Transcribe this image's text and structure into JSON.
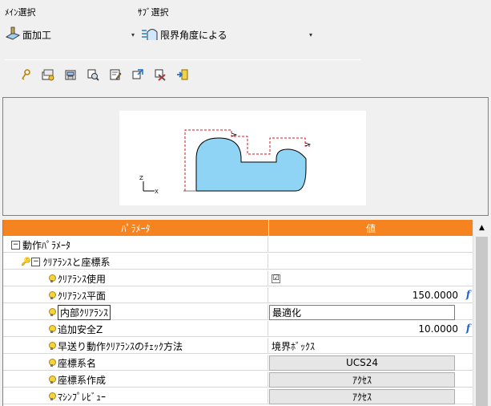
{
  "main_select": {
    "label": "ﾒｲﾝ選択",
    "value": "面加工"
  },
  "sub_select": {
    "label": "ｻﾌﾞ選択",
    "value": "限界角度による"
  },
  "toolbar": {
    "buttons": [
      "key-icon",
      "open-folder-icon",
      "save-folder-icon",
      "search-icon",
      "edit-icon",
      "import-icon",
      "tools-icon",
      "export-icon"
    ]
  },
  "grid": {
    "header": {
      "param": "ﾊﾟﾗﾒｰﾀ",
      "value": "値"
    },
    "group": "動作ﾊﾟﾗﾒｰﾀ",
    "subgroup": "ｸﾘｱﾗﾝｽと座標系",
    "rows": [
      {
        "name": "ｸﾘｱﾗﾝｽ使用",
        "value": "☑",
        "type": "checkbox"
      },
      {
        "name": "ｸﾘｱﾗﾝｽ平面",
        "value": "150.0000",
        "type": "number"
      },
      {
        "name": "内部ｸﾘｱﾗﾝｽ",
        "value": "最適化",
        "type": "combo"
      },
      {
        "name": "追加安全Z",
        "value": "10.0000",
        "type": "number"
      },
      {
        "name": "早送り動作ｸﾘｱﾗﾝｽのﾁｪｯｸ方法",
        "value": "境界ﾎﾞｯｸｽ",
        "type": "text"
      },
      {
        "name": "座標系名",
        "value": "UCS24",
        "type": "button"
      },
      {
        "name": "座標系作成",
        "value": "ｱｸｾｽ",
        "type": "button"
      },
      {
        "name": "ﾏｼﾝﾌﾟﾚﾋﾞｭｰ",
        "value": "ｱｸｾｽ",
        "type": "button"
      }
    ],
    "fx_symbol": "f"
  },
  "colors": {
    "header": "#f5831f",
    "part_fill": "#8fd3f5",
    "clearance_line": "#e0141e",
    "scrollbar_thumb": "#c8c8c8"
  }
}
